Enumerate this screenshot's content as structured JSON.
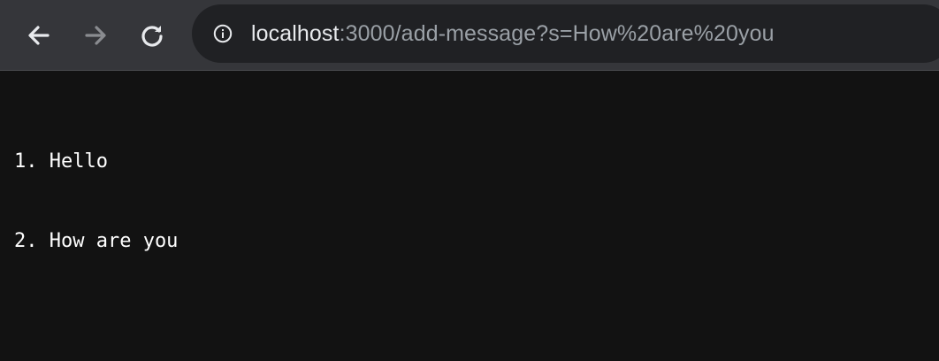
{
  "toolbar": {
    "back_icon": "arrow-left-icon",
    "forward_icon": "arrow-right-icon",
    "reload_icon": "reload-icon",
    "info_icon": "info-icon",
    "url_host": "localhost",
    "url_rest": ":3000/add-message?s=How%20are%20you"
  },
  "colors": {
    "toolbar_bg": "#35363a",
    "omnibox_bg": "#202124",
    "page_bg": "#121212",
    "text": "#ffffff"
  },
  "messages": [
    {
      "line": "1. Hello"
    },
    {
      "line": "2. How are you"
    }
  ]
}
